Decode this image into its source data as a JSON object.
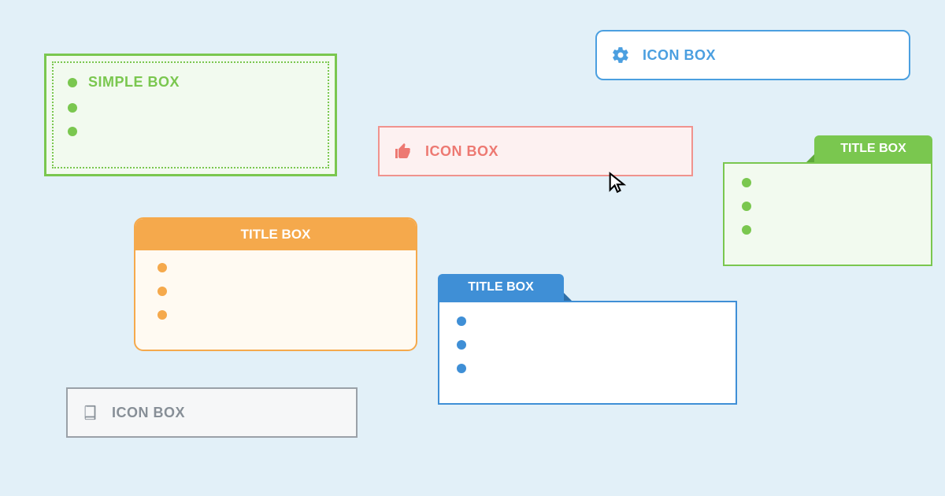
{
  "simple_box": {
    "title": "SIMPLE BOX"
  },
  "icon_box_blue": {
    "title": "ICON BOX",
    "icon": "gear-icon"
  },
  "icon_box_red": {
    "title": "ICON BOX",
    "icon": "thumbs-up-icon"
  },
  "icon_box_gray": {
    "title": "ICON BOX",
    "icon": "book-icon"
  },
  "title_box_orange": {
    "title": "TITLE BOX"
  },
  "title_box_green": {
    "title": "TITLE BOX"
  },
  "title_box_blue": {
    "title": "TITLE BOX"
  },
  "colors": {
    "green": "#7ac74f",
    "blue": "#4b9fe0",
    "red": "#ed7972",
    "orange": "#f5a94c",
    "tab_blue": "#3f8fd6",
    "gray": "#9aa1a8",
    "bg": "#e2f0f8"
  }
}
